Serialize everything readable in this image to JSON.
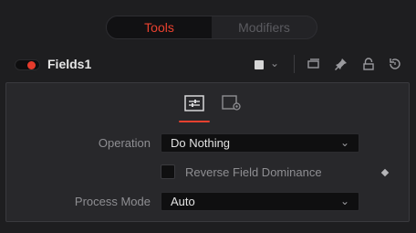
{
  "tabs": [
    {
      "label": "Tools",
      "active": true
    },
    {
      "label": "Modifiers",
      "active": false
    }
  ],
  "header": {
    "node_name": "Fields1",
    "toggle_color": "#e53b2c",
    "swatch_color": "#d6d6d6",
    "icons": [
      "color-swatch-icon",
      "chevron-down-icon",
      "versions-icon",
      "pin-icon",
      "lock-icon",
      "reset-icon"
    ]
  },
  "panel": {
    "tab_icons": [
      "controls-icon",
      "settings-icon"
    ],
    "active_tab_color": "#e8412f",
    "operation": {
      "label": "Operation",
      "value": "Do Nothing"
    },
    "reverse_field_dominance": {
      "label": "Reverse Field Dominance",
      "checked": false
    },
    "process_mode": {
      "label": "Process Mode",
      "value": "Auto"
    }
  }
}
